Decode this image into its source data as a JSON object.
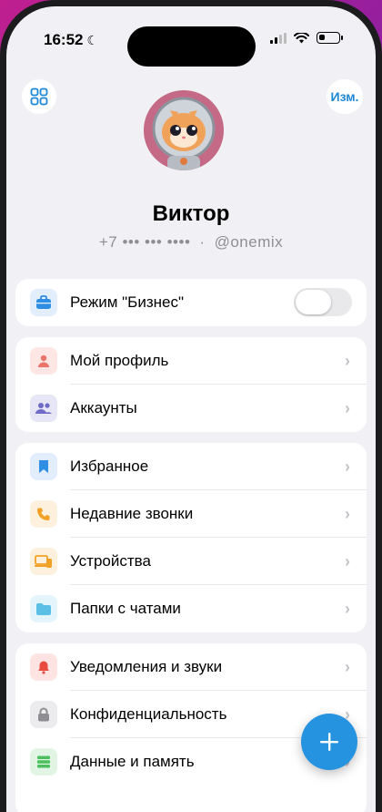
{
  "status": {
    "time": "16:52"
  },
  "header": {
    "edit_label": "Изм."
  },
  "profile": {
    "name": "Виктор",
    "phone": "+7 ••• ••• ••••",
    "separator": "·",
    "username": "@onemix"
  },
  "business": {
    "label": "Режим \"Бизнес\"",
    "toggle_on": false
  },
  "section1": [
    {
      "label": "Мой профиль",
      "icon": "person-icon",
      "color": "#e8746a",
      "bg": "#fde6e4"
    },
    {
      "label": "Аккаунты",
      "icon": "accounts-icon",
      "color": "#6f6ac6",
      "bg": "#e7e6f7"
    }
  ],
  "section2": [
    {
      "label": "Избранное",
      "icon": "bookmark-icon",
      "color": "#2f8de4",
      "bg": "#e2eefb"
    },
    {
      "label": "Недавние звонки",
      "icon": "phone-icon",
      "color": "#f2a126",
      "bg": "#fdf0dc"
    },
    {
      "label": "Устройства",
      "icon": "devices-icon",
      "color": "#f2a126",
      "bg": "#fdf0dc"
    },
    {
      "label": "Папки с чатами",
      "icon": "folder-icon",
      "color": "#5bbfe6",
      "bg": "#e4f4fb"
    }
  ],
  "section3": [
    {
      "label": "Уведомления и звуки",
      "icon": "bell-icon",
      "color": "#ea4b3f",
      "bg": "#fde4e2"
    },
    {
      "label": "Конфиденциальность",
      "icon": "lock-icon",
      "color": "#8e8e93",
      "bg": "#ececee"
    },
    {
      "label": "Данные и память",
      "icon": "storage-icon",
      "color": "#4cbf5f",
      "bg": "#e2f5e4"
    }
  ]
}
